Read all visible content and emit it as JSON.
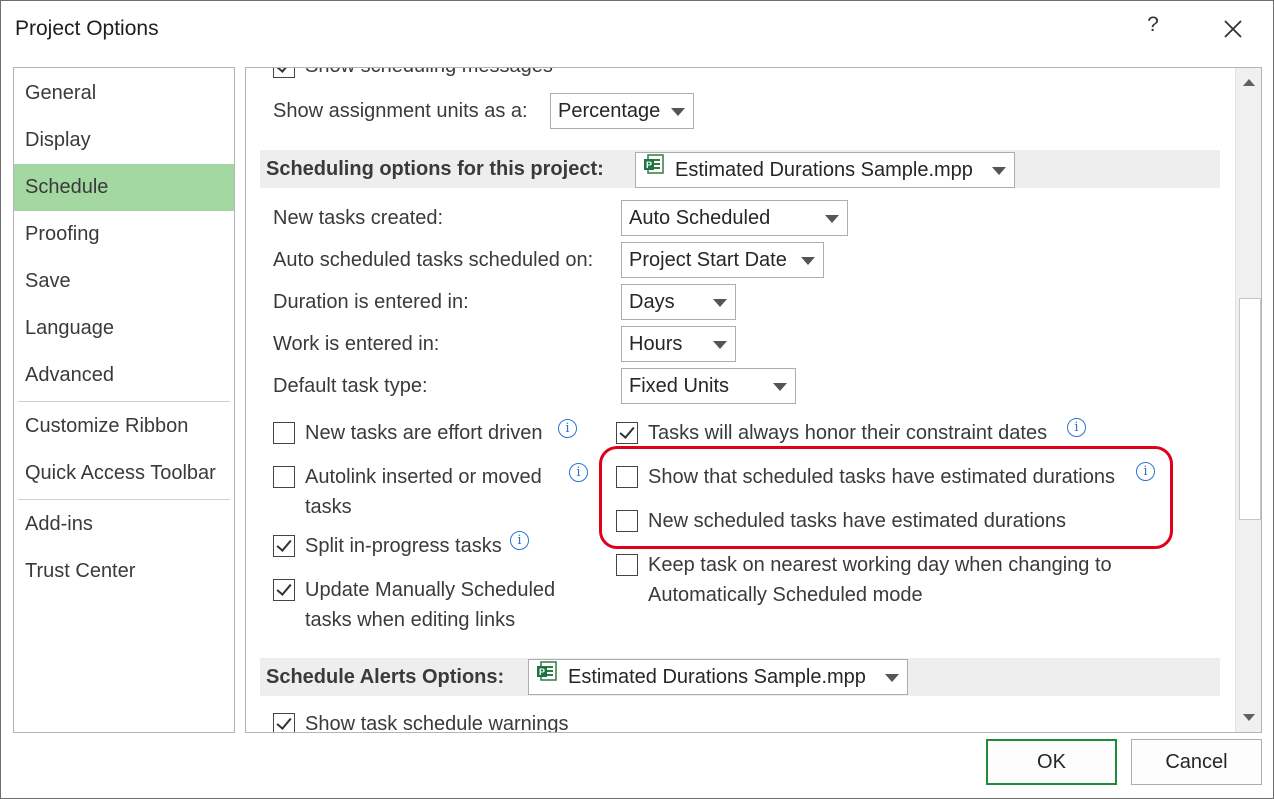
{
  "dialog": {
    "title": "Project Options",
    "help_label": "?"
  },
  "nav": {
    "items": [
      {
        "label": "General"
      },
      {
        "label": "Display"
      },
      {
        "label": "Schedule",
        "selected": true
      },
      {
        "label": "Proofing"
      },
      {
        "label": "Save"
      },
      {
        "label": "Language"
      },
      {
        "label": "Advanced"
      },
      {
        "label": "Customize Ribbon"
      },
      {
        "label": "Quick Access Toolbar"
      },
      {
        "label": "Add-ins"
      },
      {
        "label": "Trust Center"
      }
    ]
  },
  "content": {
    "cut_off_option": "Show scheduling messages",
    "assignment_units": {
      "label": "Show assignment units as a:",
      "value": "Percentage"
    },
    "scheduling_section": {
      "label": "Scheduling options for this project:",
      "project": "Estimated Durations Sample.mpp"
    },
    "settings": {
      "new_tasks": {
        "label": "New tasks created:",
        "value": "Auto Scheduled"
      },
      "auto_scheduled_on": {
        "label": "Auto scheduled tasks scheduled on:",
        "value": "Project Start Date"
      },
      "duration_entered": {
        "label": "Duration is entered in:",
        "value": "Days"
      },
      "work_entered": {
        "label": "Work is entered in:",
        "value": "Hours"
      },
      "default_task_type": {
        "label": "Default task type:",
        "value": "Fixed Units"
      }
    },
    "checkboxes_left": {
      "effort_driven": {
        "label": "New tasks are effort driven",
        "checked": false
      },
      "autolink": {
        "label_line1": "Autolink inserted or moved",
        "label_line2": "tasks",
        "checked": false
      },
      "split_in_progress": {
        "label": "Split in-progress tasks",
        "checked": true
      },
      "update_manual": {
        "label_line1": "Update Manually Scheduled",
        "label_line2": "tasks when editing links",
        "checked": true
      }
    },
    "checkboxes_right": {
      "honor_constraints": {
        "label": "Tasks will always honor their constraint dates",
        "checked": true
      },
      "show_estimated": {
        "label": "Show that scheduled tasks have estimated durations",
        "checked": false
      },
      "new_estimated": {
        "label": "New scheduled tasks have estimated durations",
        "checked": false
      },
      "keep_on_working_day": {
        "label_line1": "Keep task on nearest working day when changing to",
        "label_line2": "Automatically Scheduled mode",
        "checked": false
      }
    },
    "alerts_section": {
      "label": "Schedule Alerts Options:",
      "project": "Estimated Durations Sample.mpp"
    },
    "show_warnings": {
      "label": "Show task schedule warnings",
      "checked": true
    },
    "info_glyph": "i"
  },
  "footer": {
    "ok_label": "OK",
    "cancel_label": "Cancel"
  },
  "colors": {
    "selected_nav": "#a3d8a3",
    "highlight_outline": "#e0001b",
    "default_button_border": "#1f8b3a",
    "info_icon": "#2e75c8"
  }
}
